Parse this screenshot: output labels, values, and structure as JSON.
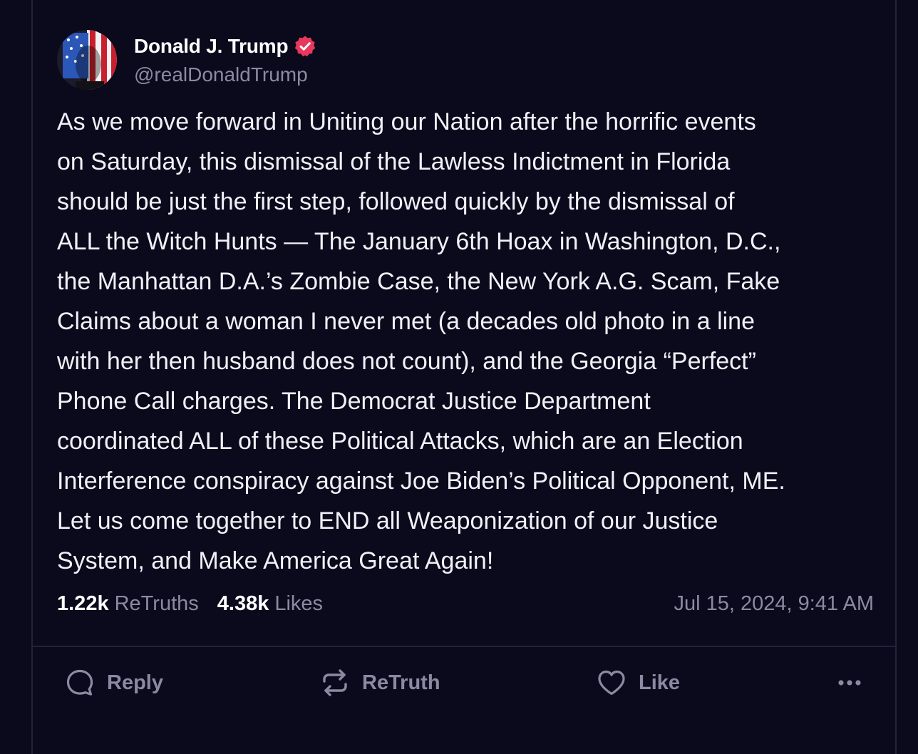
{
  "author": {
    "display_name": "Donald J. Trump",
    "handle": "@realDonaldTrump",
    "verified": true,
    "verified_badge_color": "#e8385c"
  },
  "post": {
    "text": "As we move forward in Uniting our Nation after the horrific events\non Saturday, this dismissal of the Lawless Indictment in Florida\nshould be just the first step, followed quickly by the dismissal of\nALL the Witch Hunts — The January 6th Hoax in Washington, D.C.,\nthe Manhattan D.A.’s Zombie Case, the New York A.G. Scam, Fake\nClaims about a woman I never met (a decades old photo in a line\nwith her then husband does not count), and the Georgia “Perfect”\nPhone Call charges. The Democrat Justice Department\ncoordinated ALL of these Political Attacks, which are an Election\nInterference conspiracy against Joe Biden’s Political Opponent, ME.\nLet us come together to END all Weaponization of our Justice\nSystem, and Make America Great Again!"
  },
  "stats": {
    "retruths_count": "1.22k",
    "retruths_label": "ReTruths",
    "likes_count": "4.38k",
    "likes_label": "Likes",
    "timestamp": "Jul 15, 2024, 9:41 AM"
  },
  "actions": {
    "reply_label": "Reply",
    "retruth_label": "ReTruth",
    "like_label": "Like"
  },
  "icons": {
    "reply": "reply-bubble-icon",
    "retruth": "retruth-arrows-icon",
    "like": "heart-icon",
    "more": "more-dots-icon",
    "verified": "verified-badge-icon"
  },
  "colors": {
    "background": "#0b0a1c",
    "text": "#f1f0f7",
    "muted": "#8b8aa3",
    "border": "#23223a"
  }
}
